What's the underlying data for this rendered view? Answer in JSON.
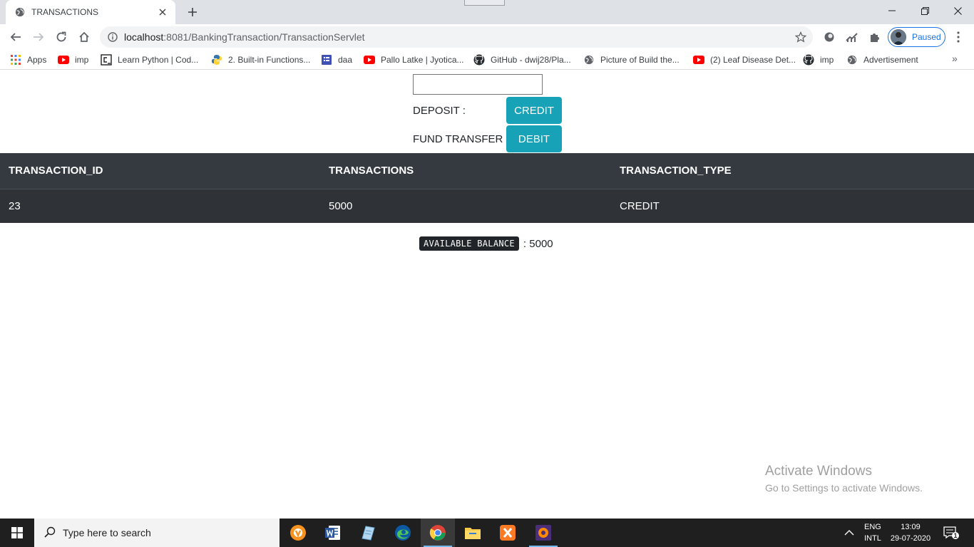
{
  "browser": {
    "tab_title": "TRANSACTIONS",
    "url_host": "localhost",
    "url_rest": ":8081/BankingTransaction/TransactionServlet",
    "profile_label": "Paused",
    "bookmarks": [
      {
        "label": "Apps",
        "icon": "apps-grid-icon"
      },
      {
        "label": "imp",
        "icon": "youtube-icon"
      },
      {
        "label": "Learn Python | Cod...",
        "icon": "code-icon"
      },
      {
        "label": "2. Built-in Functions...",
        "icon": "python-icon"
      },
      {
        "label": "daa",
        "icon": "form-icon"
      },
      {
        "label": "Pallo Latke | Jyotica...",
        "icon": "youtube-icon"
      },
      {
        "label": "GitHub - dwij28/Pla...",
        "icon": "github-icon"
      },
      {
        "label": "Picture of Build the...",
        "icon": "globe-icon"
      },
      {
        "label": "(2) Leaf Disease Det...",
        "icon": "youtube-icon"
      },
      {
        "label": "imp",
        "icon": "github-icon"
      },
      {
        "label": "Advertisement",
        "icon": "globe-icon"
      }
    ],
    "bookmarks_more": "»"
  },
  "form": {
    "amount_value": "",
    "deposit_label": "DEPOSIT :",
    "credit_button": "CREDIT",
    "transfer_label": "FUND TRANSFER :",
    "debit_button": "DEBIT"
  },
  "table": {
    "headers": [
      "TRANSACTION_ID",
      "TRANSACTIONS",
      "TRANSACTION_TYPE"
    ],
    "rows": [
      [
        "23",
        "5000",
        "CREDIT"
      ]
    ]
  },
  "balance": {
    "label": "AVAILABLE BALANCE",
    "separator": ": 5000"
  },
  "watermark": {
    "line1": "Activate Windows",
    "line2": "Go to Settings to activate Windows."
  },
  "taskbar": {
    "search_placeholder": "Type here to search",
    "lang_line1": "ENG",
    "lang_line2": "INTL",
    "time": "13:09",
    "date": "29-07-2020",
    "notification_count": "1"
  },
  "colors": {
    "accent_info": "#17a2b8",
    "table_dark": "#343a40",
    "profile_blue": "#1a73e8"
  }
}
